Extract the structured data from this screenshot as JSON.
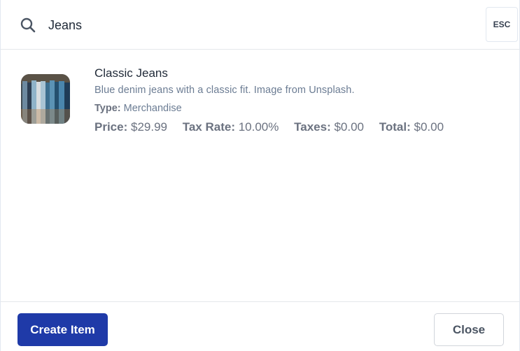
{
  "search": {
    "value": "Jeans",
    "icon": "search-icon",
    "esc_label": "ESC"
  },
  "results": [
    {
      "name": "Classic Jeans",
      "description": "Blue denim jeans with a classic fit. Image from Unsplash.",
      "type_label": "Type:",
      "type_value": "Merchandise",
      "price_label": "Price:",
      "price_value": "$29.99",
      "tax_rate_label": "Tax Rate:",
      "tax_rate_value": "10.00%",
      "taxes_label": "Taxes:",
      "taxes_value": "$0.00",
      "total_label": "Total:",
      "total_value": "$0.00"
    }
  ],
  "footer": {
    "create_label": "Create Item",
    "close_label": "Close"
  },
  "colors": {
    "primary": "#1f3aa8",
    "muted_text": "#6b7c93",
    "border": "#e5e7eb"
  }
}
